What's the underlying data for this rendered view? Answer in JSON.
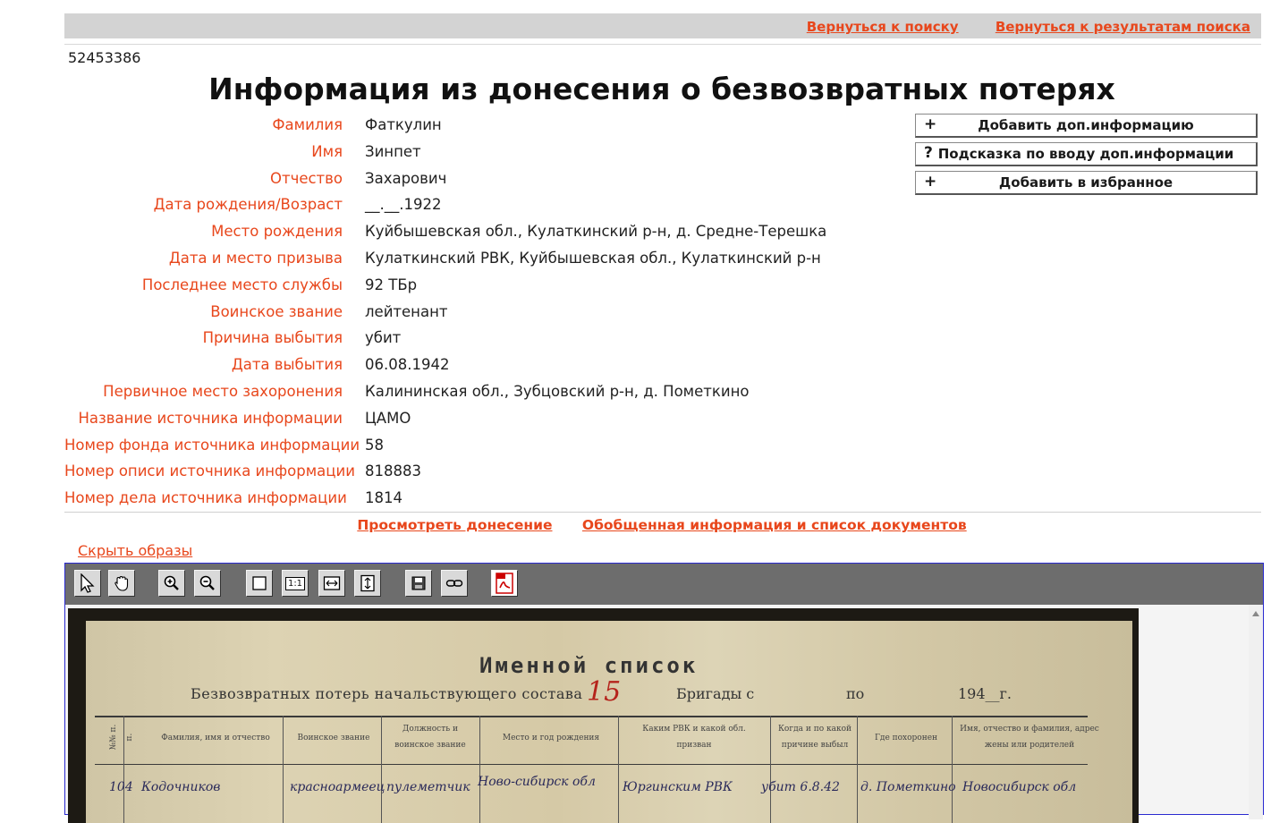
{
  "nav": {
    "back_to_search": "Вернуться к поиску",
    "back_to_results": "Вернуться к результатам поиска"
  },
  "record_id": "52453386",
  "title": "Информация из донесения о безвозвратных потерях",
  "fields": [
    {
      "label": "Фамилия",
      "value": "Фаткулин"
    },
    {
      "label": "Имя",
      "value": "Зинпет"
    },
    {
      "label": "Отчество",
      "value": "Захарович"
    },
    {
      "label": "Дата рождения/Возраст",
      "value": "__.__.1922"
    },
    {
      "label": "Место рождения",
      "value": "Куйбышевская обл., Кулаткинский р-н, д. Средне-Терешка"
    },
    {
      "label": "Дата и место призыва",
      "value": "Кулаткинский РВК, Куйбышевская обл., Кулаткинский р-н"
    },
    {
      "label": "Последнее место службы",
      "value": "92 ТБр"
    },
    {
      "label": "Воинское звание",
      "value": "лейтенант"
    },
    {
      "label": "Причина выбытия",
      "value": "убит"
    },
    {
      "label": "Дата выбытия",
      "value": "06.08.1942"
    },
    {
      "label": "Первичное место захоронения",
      "value": "Калининская обл., Зубцовский р-н, д. Пометкино"
    },
    {
      "label": "Название источника информации",
      "value": "ЦАМО"
    },
    {
      "label": "Номер фонда источника информации",
      "value": "58"
    },
    {
      "label": "Номер описи источника информации",
      "value": "818883"
    },
    {
      "label": "Номер дела источника информации",
      "value": "1814"
    }
  ],
  "actions": [
    {
      "symbol": "+",
      "label": "Добавить доп.информацию"
    },
    {
      "symbol": "?",
      "label": "Подсказка по вводу доп.информации"
    },
    {
      "symbol": "+",
      "label": "Добавить в избранное"
    }
  ],
  "links": {
    "view_report": "Просмотреть донесение",
    "summary_docs": "Обобщенная информация и список документов",
    "hide_images": "Скрыть образы"
  },
  "toolbar": {
    "tools": [
      "select-tool",
      "pan-tool",
      "zoom-in",
      "zoom-out",
      "fit-page",
      "actual-size",
      "fit-width",
      "fit-height",
      "save",
      "link",
      "pdf"
    ],
    "actual_size_label": "1:1",
    "pdf_label": "PDF"
  },
  "document": {
    "title": "Именной список",
    "subtitle": "Безвозвратных потерь начальствующего состава",
    "brigade": "Бригады с",
    "po": "по",
    "year": "194__г.",
    "mark": "15",
    "columns": [
      "№№ п. п.",
      "Фамилия, имя и отчество",
      "Воинское звание",
      "Должность и воинское звание",
      "Место и год рождения",
      "Каким РВК и какой обл. призван",
      "Когда и по какой причине выбыл",
      "Где похоронен",
      "Имя, отчество и фамилия, адрес жены или родителей"
    ],
    "row": {
      "num": "104",
      "name": "Кодочников",
      "rank": "красноармеец",
      "post": "пулеметчик",
      "birth": "Ново-сибирск обл",
      "rvk": "Юргинским РВК",
      "when": "убит 6.8.42",
      "buried": "д. Пометкино",
      "kin": "Новосибирск обл"
    }
  }
}
